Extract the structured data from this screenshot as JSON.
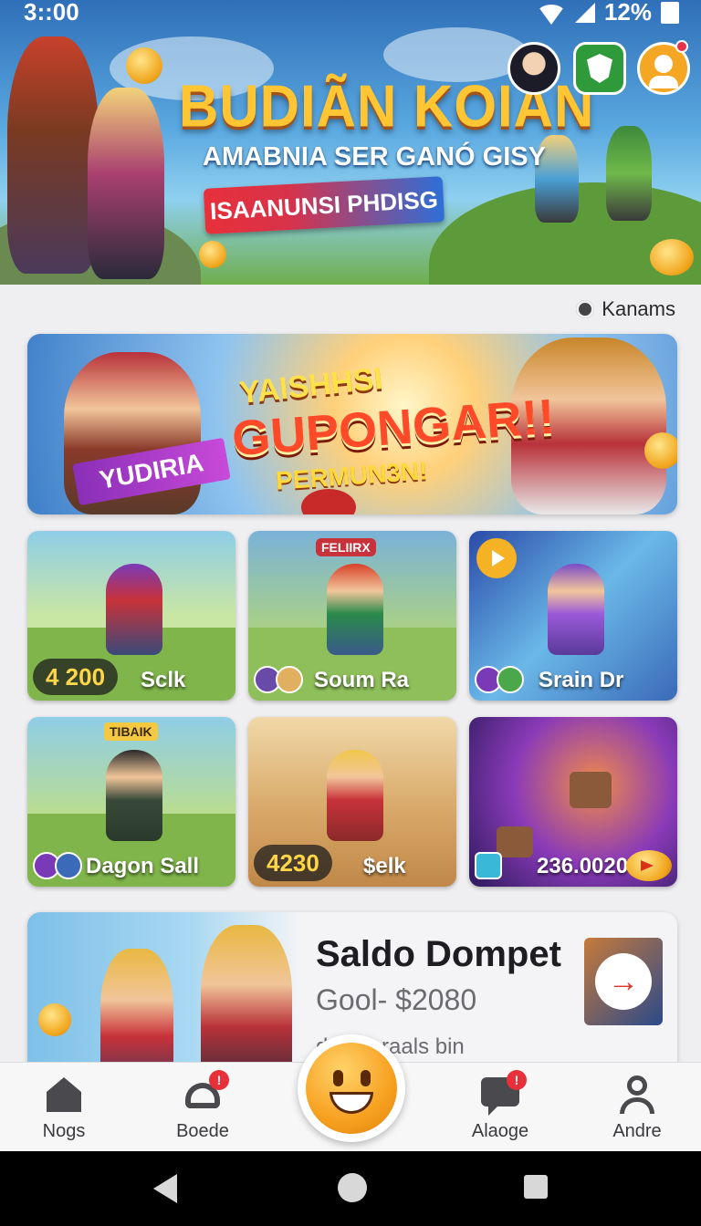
{
  "status_bar": {
    "time": "3::00",
    "battery": "12%"
  },
  "hero": {
    "title": "BUDIÃN KOIAN",
    "subtitle": "AMABNIA SER GANÓ GISY",
    "button_label": "ISAANUNSI PHDISG"
  },
  "filter": {
    "label": "Kanams"
  },
  "promo": {
    "line1": "YAISHHSI",
    "line2": "GUPONGAR!!",
    "line3": "PERMUN3N!",
    "tag": "YUDIRIA"
  },
  "games": [
    {
      "value": "4 200",
      "label": "Sclk"
    },
    {
      "badge": "FELIIRX",
      "label": "Soum Ra"
    },
    {
      "label": "Srain Dr"
    },
    {
      "badge": "TIBAIK",
      "label": "Dagon Sall"
    },
    {
      "value": "4230",
      "label": "$elk"
    },
    {
      "label": "236.0020"
    }
  ],
  "wallet": {
    "title": "Saldo Dompet",
    "goal": "Gool- $2080",
    "desc": "day deraals bin"
  },
  "nav": {
    "items": [
      {
        "label": "Nogs"
      },
      {
        "label": "Boede",
        "badge": "!"
      },
      {
        "label": "Alaoge",
        "badge": "!"
      },
      {
        "label": "Andre"
      }
    ]
  },
  "colors": {
    "accent": "#f5a623",
    "hero_title": "#ffc533",
    "badge": "#e8303a"
  }
}
